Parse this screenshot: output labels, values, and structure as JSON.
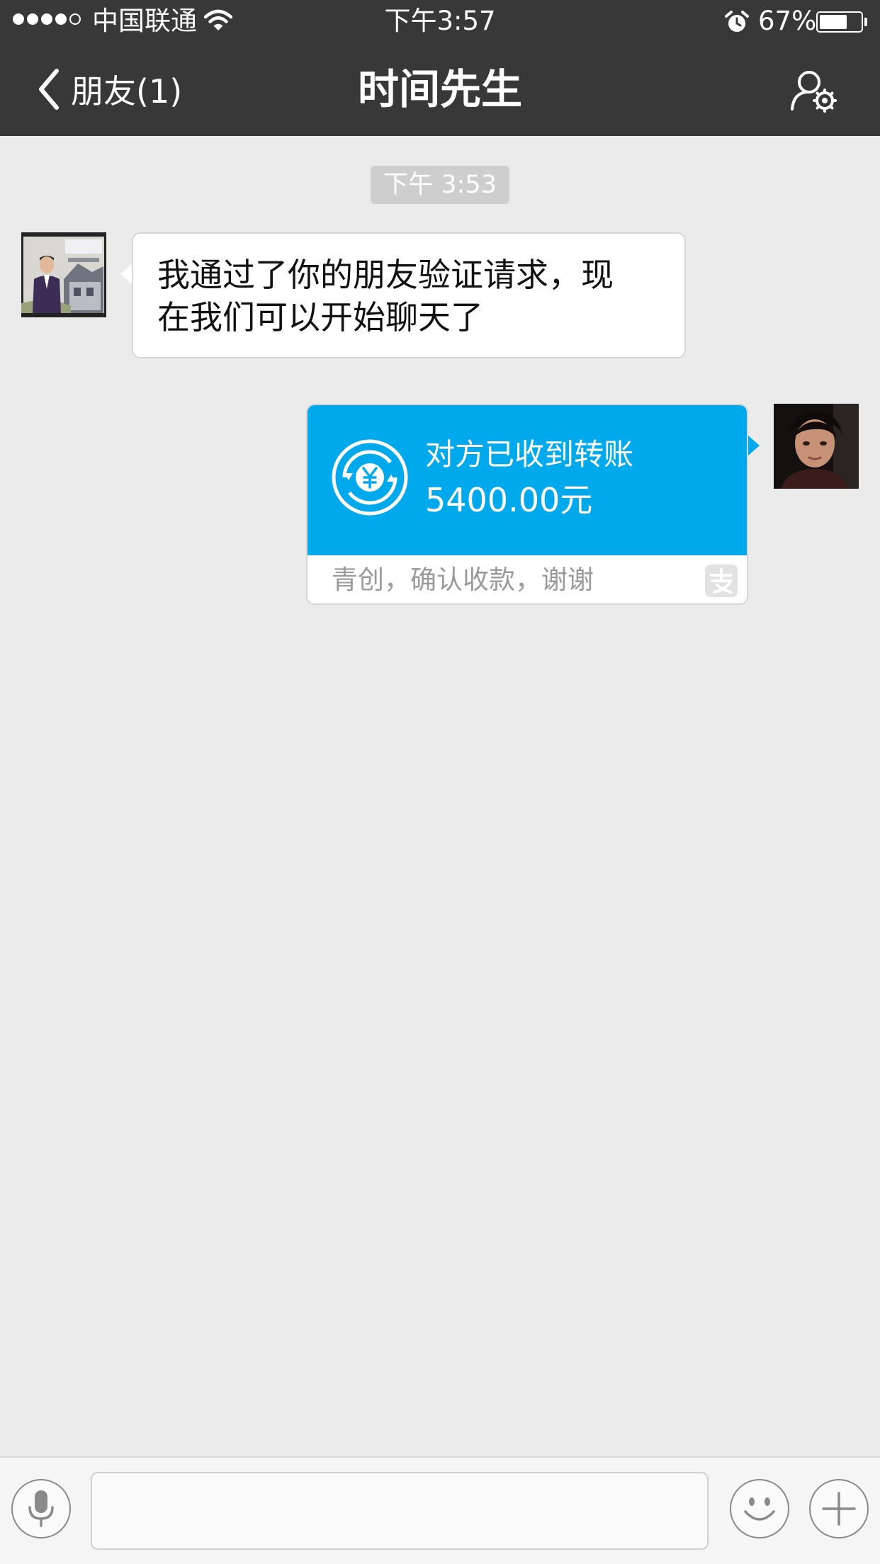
{
  "status_bar": {
    "carrier": "中国联通",
    "time": "下午3:57",
    "battery_percent": "67%",
    "battery_level": 0.67,
    "signal_bars_filled": 4,
    "signal_bars_total": 5
  },
  "nav": {
    "back_label": "朋友(1)",
    "title": "时间先生",
    "settings_icon": "user-settings-icon"
  },
  "chat": {
    "timestamp": "下午 3:53",
    "incoming_message": {
      "text": "我通过了你的朋友验证请求，现在我们可以开始聊天了",
      "line1": "我通过了你的朋友验证请求，现",
      "line2": "在我们可以开始聊天了"
    },
    "transfer": {
      "status": "对方已收到转账",
      "amount": "5400.00元",
      "note": "青创，确认收款，谢谢",
      "icon": "yuan-transfer-icon",
      "source_logo": "alipay-logo-icon",
      "color": "#00a8ec"
    }
  },
  "input_bar": {
    "voice_icon": "microphone-icon",
    "emoji_icon": "smiley-icon",
    "more_icon": "plus-icon",
    "placeholder": ""
  }
}
